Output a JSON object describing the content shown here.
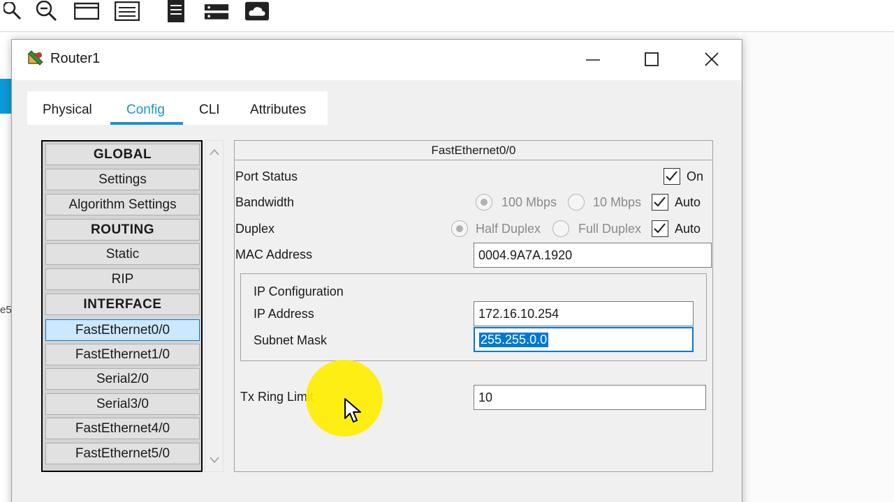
{
  "window": {
    "title": "Router1"
  },
  "tabs": [
    {
      "label": "Physical"
    },
    {
      "label": "Config"
    },
    {
      "label": "CLI"
    },
    {
      "label": "Attributes"
    }
  ],
  "sidebar": {
    "items": [
      {
        "label": "GLOBAL"
      },
      {
        "label": "Settings"
      },
      {
        "label": "Algorithm Settings"
      },
      {
        "label": "ROUTING"
      },
      {
        "label": "Static"
      },
      {
        "label": "RIP"
      },
      {
        "label": "INTERFACE"
      },
      {
        "label": "FastEthernet0/0"
      },
      {
        "label": "FastEthernet1/0"
      },
      {
        "label": "Serial2/0"
      },
      {
        "label": "Serial3/0"
      },
      {
        "label": "FastEthernet4/0"
      },
      {
        "label": "FastEthernet5/0"
      }
    ]
  },
  "interface": {
    "title": "FastEthernet0/0",
    "port_status_label": "Port Status",
    "port_status_on_label": "On",
    "bandwidth_label": "Bandwidth",
    "bandwidth_100": "100 Mbps",
    "bandwidth_10": "10 Mbps",
    "bandwidth_auto": "Auto",
    "duplex_label": "Duplex",
    "duplex_half": "Half Duplex",
    "duplex_full": "Full Duplex",
    "duplex_auto": "Auto",
    "mac_label": "MAC Address",
    "mac_value": "0004.9A7A.1920",
    "ip_config_label": "IP Configuration",
    "ip_address_label": "IP Address",
    "ip_address_value": "172.16.10.254",
    "subnet_mask_label": "Subnet Mask",
    "subnet_mask_value": "255.255.0.0",
    "tx_ring_label": "Tx Ring Limit",
    "tx_ring_value": "10"
  },
  "background": {
    "left_fragment": "e5"
  },
  "colors": {
    "accent": "#1a93d5",
    "selection": "#0078d7",
    "cursor_highlight": "#ffee00"
  }
}
